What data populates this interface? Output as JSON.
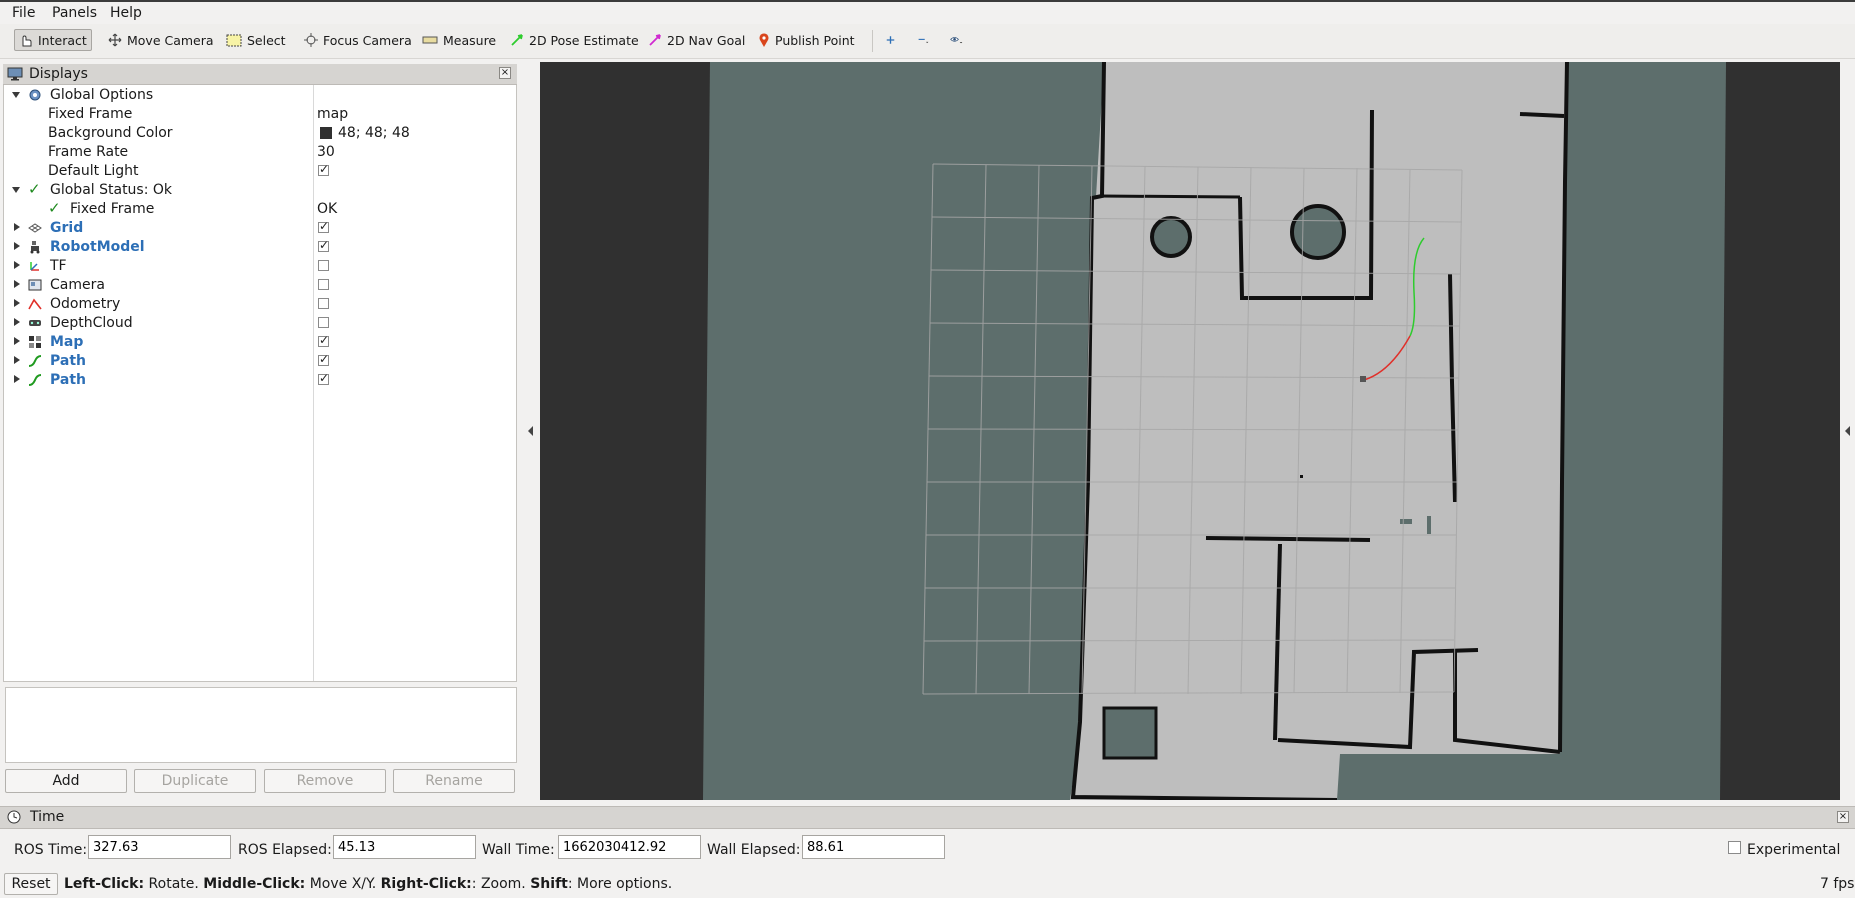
{
  "menu": {
    "file": "File",
    "panels": "Panels",
    "help": "Help"
  },
  "toolbar": {
    "interact": "Interact",
    "move_camera": "Move Camera",
    "select": "Select",
    "focus_camera": "Focus Camera",
    "measure": "Measure",
    "pose_estimate": "2D Pose Estimate",
    "nav_goal": "2D Nav Goal",
    "publish_point": "Publish Point"
  },
  "displays": {
    "title": "Displays",
    "global_options": {
      "label": "Global Options",
      "fixed_frame_label": "Fixed Frame",
      "fixed_frame_value": "map",
      "background_color_label": "Background Color",
      "background_color_value": "48; 48; 48",
      "background_color_hex": "#303030",
      "frame_rate_label": "Frame Rate",
      "frame_rate_value": "30",
      "default_light_label": "Default Light",
      "default_light_checked": true
    },
    "global_status": {
      "label": "Global Status: Ok",
      "fixed_frame_label": "Fixed Frame",
      "fixed_frame_value": "OK"
    },
    "items": [
      {
        "label": "Grid",
        "icon": "grid-icon",
        "checked": true,
        "highlight": true
      },
      {
        "label": "RobotModel",
        "icon": "robot-model-icon",
        "checked": true,
        "highlight": true
      },
      {
        "label": "TF",
        "icon": "tf-icon",
        "checked": false,
        "highlight": false
      },
      {
        "label": "Camera",
        "icon": "camera-icon",
        "checked": false,
        "highlight": false
      },
      {
        "label": "Odometry",
        "icon": "odometry-icon",
        "checked": false,
        "highlight": false
      },
      {
        "label": "DepthCloud",
        "icon": "depthcloud-icon",
        "checked": false,
        "highlight": false
      },
      {
        "label": "Map",
        "icon": "map-icon",
        "checked": true,
        "highlight": true
      },
      {
        "label": "Path",
        "icon": "path-icon",
        "checked": true,
        "highlight": true
      },
      {
        "label": "Path",
        "icon": "path-icon",
        "checked": true,
        "highlight": true
      }
    ],
    "buttons": {
      "add": "Add",
      "duplicate": "Duplicate",
      "remove": "Remove",
      "rename": "Rename"
    }
  },
  "time": {
    "title": "Time",
    "ros_time_label": "ROS Time:",
    "ros_time_value": "327.63",
    "ros_elapsed_label": "ROS Elapsed:",
    "ros_elapsed_value": "45.13",
    "wall_time_label": "Wall Time:",
    "wall_time_value": "1662030412.92",
    "wall_elapsed_label": "Wall Elapsed:",
    "wall_elapsed_value": "88.61",
    "experimental_label": "Experimental"
  },
  "status": {
    "reset": "Reset",
    "left_click": "Left-Click:",
    "left_click_desc": " Rotate. ",
    "middle_click": "Middle-Click:",
    "middle_click_desc": " Move X/Y. ",
    "right_click": "Right-Click:",
    "right_click_desc": ": Zoom. ",
    "shift": "Shift",
    "shift_desc": ": More options.",
    "fps": "7 fps"
  },
  "colors": {
    "viewport_bg": "#303030",
    "map_unknown": "#5d6e6c",
    "map_free": "#bebebe",
    "map_wall": "#111111",
    "accent_blue": "#2d6fb6",
    "path_green": "#2ecc2e",
    "path_red": "#e0302a"
  }
}
